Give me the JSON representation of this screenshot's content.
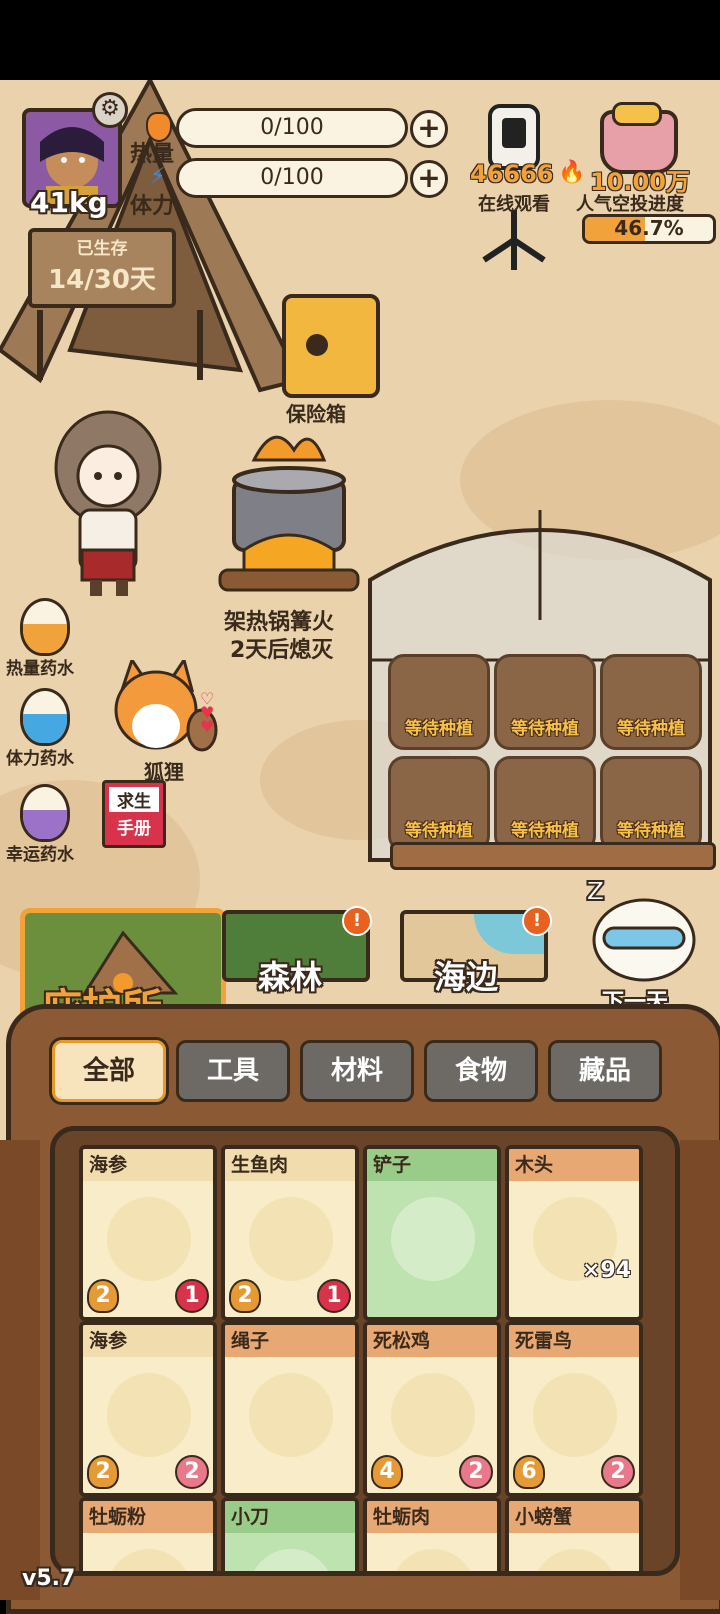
{
  "player": {
    "weight": "41kg"
  },
  "stats": {
    "heat_label": "热量",
    "heat_value": "0/100",
    "stamina_label": "体力",
    "stamina_value": "0/100"
  },
  "survival": {
    "label": "已生存",
    "days": "14/30天"
  },
  "stream": {
    "viewers": "46666",
    "viewers_label": "在线观看",
    "popularity": "10.00万",
    "popularity_label": "人气空投进度",
    "progress_text": "46.7%",
    "progress_value": 0.467
  },
  "scene": {
    "safe_label": "保险箱",
    "fire_line1": "架热锅篝火",
    "fire_line2": "2天后熄灭",
    "fox_label": "狐狸",
    "manual_line1": "求生",
    "manual_line2": "手册",
    "next_day": "下一天",
    "plots": [
      "等待种植",
      "等待种植",
      "等待种植",
      "等待种植",
      "等待种植",
      "等待种植"
    ]
  },
  "potions": [
    {
      "label": "热量药水",
      "color": "#f0a33a",
      "icon": "heat-potion-icon"
    },
    {
      "label": "体力药水",
      "color": "#46a8e0",
      "icon": "stamina-potion-icon"
    },
    {
      "label": "幸运药水",
      "color": "#9c72c8",
      "icon": "luck-potion-icon"
    }
  ],
  "locations": [
    {
      "label": "庇护所",
      "active": true
    },
    {
      "label": "森林",
      "alert": "!"
    },
    {
      "label": "海边",
      "alert": "!"
    }
  ],
  "tabs": [
    "全部",
    "工具",
    "材料",
    "食物",
    "藏品"
  ],
  "active_tab": 0,
  "items": [
    {
      "name": "海参",
      "left": "2",
      "right": "1",
      "right_style": "red",
      "style": "cream",
      "icon": "sea-cucumber-icon"
    },
    {
      "name": "生鱼肉",
      "left": "2",
      "right": "1",
      "right_style": "red",
      "style": "cream",
      "icon": "raw-fish-icon"
    },
    {
      "name": "铲子",
      "style": "green",
      "icon": "shovel-icon"
    },
    {
      "name": "木头",
      "count": "×94",
      "style": "tan",
      "icon": "wood-log-icon"
    },
    {
      "name": "海参",
      "left": "2",
      "right": "2",
      "right_style": "pink",
      "style": "cream",
      "icon": "sea-cucumber-icon"
    },
    {
      "name": "绳子",
      "style": "tan",
      "icon": "rope-icon"
    },
    {
      "name": "死松鸡",
      "left": "4",
      "right": "2",
      "right_style": "pink",
      "style": "tan",
      "icon": "dead-grouse-icon"
    },
    {
      "name": "死雷鸟",
      "left": "6",
      "right": "2",
      "right_style": "pink",
      "style": "tan",
      "icon": "dead-ptarmigan-icon"
    },
    {
      "name": "牡蛎粉",
      "style": "tan",
      "icon": "oyster-powder-icon"
    },
    {
      "name": "小刀",
      "style": "green",
      "icon": "knife-icon"
    },
    {
      "name": "牡蛎肉",
      "style": "tan",
      "icon": "oyster-meat-icon"
    },
    {
      "name": "小螃蟹",
      "style": "tan",
      "icon": "small-crab-icon"
    }
  ],
  "version": "v5.7"
}
